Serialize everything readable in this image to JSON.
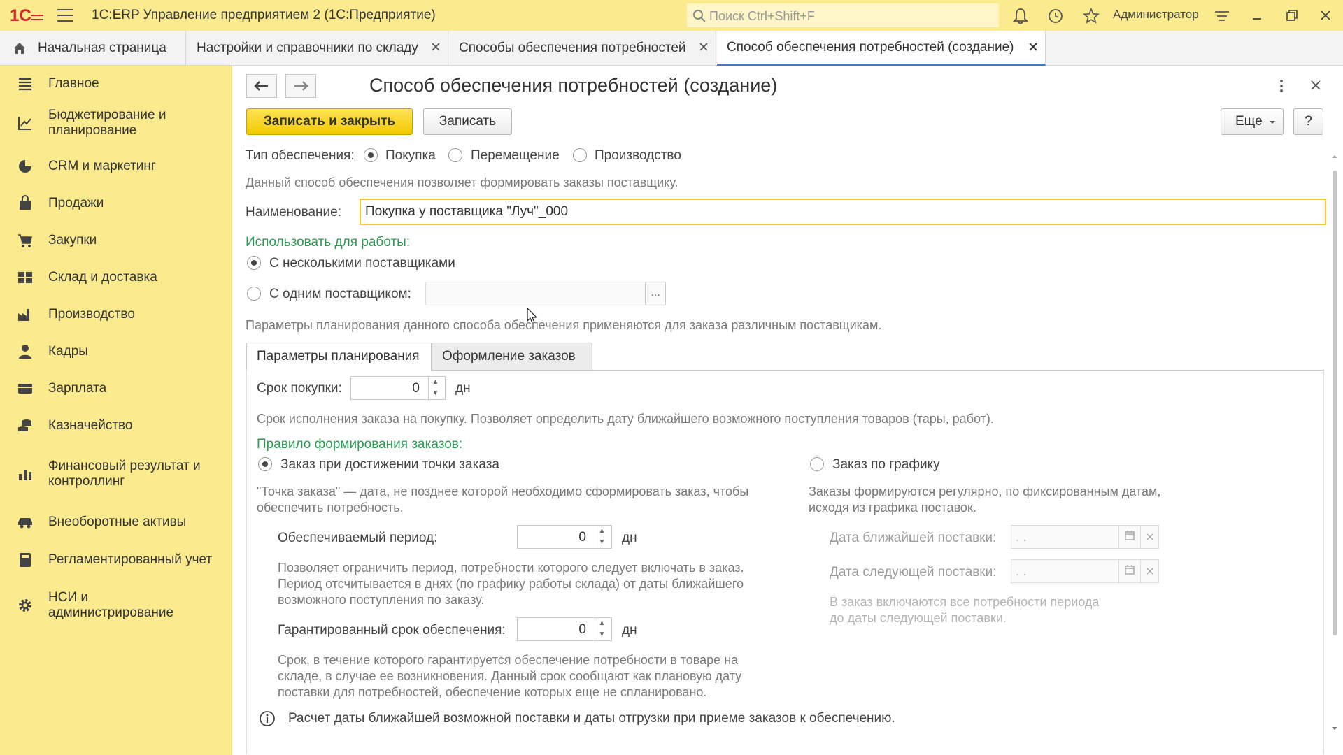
{
  "titlebar": {
    "app_title": "1С:ERP Управление предприятием 2  (1С:Предприятие)",
    "search_placeholder": "Поиск Ctrl+Shift+F",
    "user": "Администратор"
  },
  "tabs": [
    {
      "label": "Начальная страница"
    },
    {
      "label": "Настройки и справочники по складу"
    },
    {
      "label": "Способы обеспечения потребностей"
    },
    {
      "label": "Способ обеспечения потребностей (создание)"
    }
  ],
  "sidebar": {
    "items": [
      {
        "label": "Главное",
        "icon": "menu-icon"
      },
      {
        "label": "Бюджетирование и\nпланирование",
        "icon": "budget-chart-icon"
      },
      {
        "label": "CRM и маркетинг",
        "icon": "pie-chart-icon"
      },
      {
        "label": "Продажи",
        "icon": "shopping-bag-icon"
      },
      {
        "label": "Закупки",
        "icon": "cart-icon"
      },
      {
        "label": "Склад и доставка",
        "icon": "warehouse-icon"
      },
      {
        "label": "Производство",
        "icon": "factory-icon"
      },
      {
        "label": "Кадры",
        "icon": "person-icon"
      },
      {
        "label": "Зарплата",
        "icon": "wallet-icon"
      },
      {
        "label": "Казначейство",
        "icon": "coins-icon"
      },
      {
        "label": "Финансовый результат и\nконтроллинг",
        "icon": "bar-chart-icon"
      },
      {
        "label": "Внеоборотные активы",
        "icon": "car-icon"
      },
      {
        "label": "Регламентированный учет",
        "icon": "calculator-icon"
      },
      {
        "label": "НСИ и\nадминистрирование",
        "icon": "gear-icon"
      }
    ]
  },
  "form": {
    "title": "Способ обеспечения потребностей (создание)",
    "save_close_label": "Записать и закрыть",
    "save_label": "Записать",
    "more_label": "Еще",
    "help_label": "?",
    "supply_type_label": "Тип обеспечения:",
    "supply_types": [
      "Покупка",
      "Перемещение",
      "Производство"
    ],
    "supply_type_selected": "Покупка",
    "supply_type_hint": "Данный способ обеспечения позволяет формировать заказы поставщику.",
    "name_label": "Наименование:",
    "name_value": "Покупка у поставщика \"Луч\"_000",
    "use_for_label": "Использовать для работы:",
    "use_multi": "С несколькими поставщиками",
    "use_single": "С одним поставщиком:",
    "use_selected": "С несколькими поставщиками",
    "planning_hint": "Параметры планирования данного способа обеспечения применяются для заказа различным поставщикам.",
    "subtabs": [
      "Параметры планирования",
      "Оформление заказов"
    ],
    "purchase_term_label": "Срок покупки:",
    "purchase_term_value": "0",
    "days_unit": "дн",
    "purchase_term_hint": "Срок исполнения заказа на покупку. Позволяет определить дату ближайшего возможного поступления товаров (тары, работ).",
    "order_rule_label": "Правило формирования заказов:",
    "rule_point": "Заказ при достижении точки заказа",
    "rule_schedule": "Заказ по графику",
    "rule_selected": "Заказ при достижении точки заказа",
    "rule_point_hint_1": "\"Точка заказа\" — дата, не позднее которой необходимо сформировать заказ, чтобы",
    "rule_point_hint_2": "обеспечить потребность.",
    "rule_schedule_hint_1": "Заказы формируются регулярно, по фиксированным датам,",
    "rule_schedule_hint_2": "исходя из графика поставок.",
    "covered_period_label": "Обеспечиваемый период:",
    "covered_period_value": "0",
    "covered_period_hint_1": "Позволяет ограничить период, потребности которого следует включать в заказ.",
    "covered_period_hint_2": "Период отсчитывается в днях (по графику работы склада) от даты ближайшего",
    "covered_period_hint_3": "возможного поступления по заказу.",
    "guaranteed_label": "Гарантированный срок обеспечения:",
    "guaranteed_value": "0",
    "guaranteed_hint_1": "Срок, в течение которого гарантируется обеспечение потребности в товаре на",
    "guaranteed_hint_2": "складе, в случае ее возникновения. Данный срок сообщают как плановую дату",
    "guaranteed_hint_3": "поставки для потребностей, обеспечение которых еще не спланировано.",
    "nearest_delivery_label": "Дата ближайшей поставки:",
    "next_delivery_label": "Дата следующей поставки:",
    "date_placeholder": " .  .",
    "schedule_hint_1": "В заказ включаются все потребности периода",
    "schedule_hint_2": "до даты следующей поставки.",
    "info_text": "Расчет даты ближайшей возможной поставки и даты отгрузки при приеме заказов к обеспечению.",
    "ellipsis": "..."
  },
  "colors": {
    "accent_yellow": "#fbeb8e",
    "primary_button": "#f2c900",
    "green_label": "#2a9d55",
    "active_tab_underline": "#3b7ac9"
  }
}
